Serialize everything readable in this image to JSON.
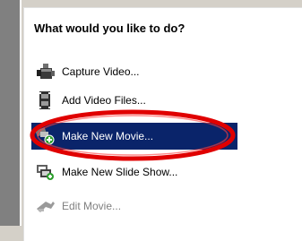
{
  "panel": {
    "heading": "What would you like to do?"
  },
  "items": [
    {
      "label": "Capture Video..."
    },
    {
      "label": "Add Video Files..."
    },
    {
      "label": "Make New Movie..."
    },
    {
      "label": "Make New Slide Show..."
    },
    {
      "label": "Edit Movie..."
    }
  ],
  "colors": {
    "selection_bg": "#0a246a",
    "highlight_ring": "#e00000",
    "disabled_text": "#808080"
  }
}
